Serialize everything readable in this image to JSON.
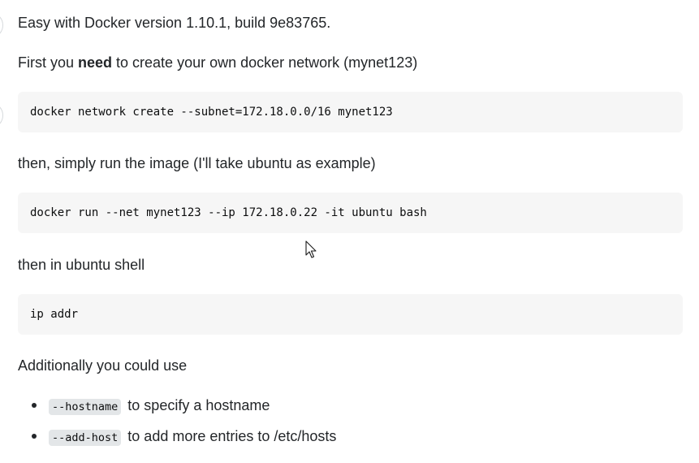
{
  "answer": {
    "line1": "Easy with Docker version 1.10.1, build 9e83765.",
    "line2": {
      "before": "First you ",
      "bold": "need",
      "after": " to create your own docker network (mynet123)"
    },
    "code1": "docker network create --subnet=172.18.0.0/16 mynet123",
    "line3": "then, simply run the image (I'll take ubuntu as example)",
    "code2": "docker run --net mynet123 --ip 172.18.0.22 -it ubuntu bash",
    "line4": "then in ubuntu shell",
    "code3": "ip addr",
    "line5": "Additionally you could use",
    "list": [
      {
        "code": "--hostname",
        "text": "to specify a hostname"
      },
      {
        "code": "--add-host",
        "text": "to add more entries to /etc/hosts"
      }
    ]
  },
  "icons": {
    "cursor": "mouse-pointer-icon"
  }
}
